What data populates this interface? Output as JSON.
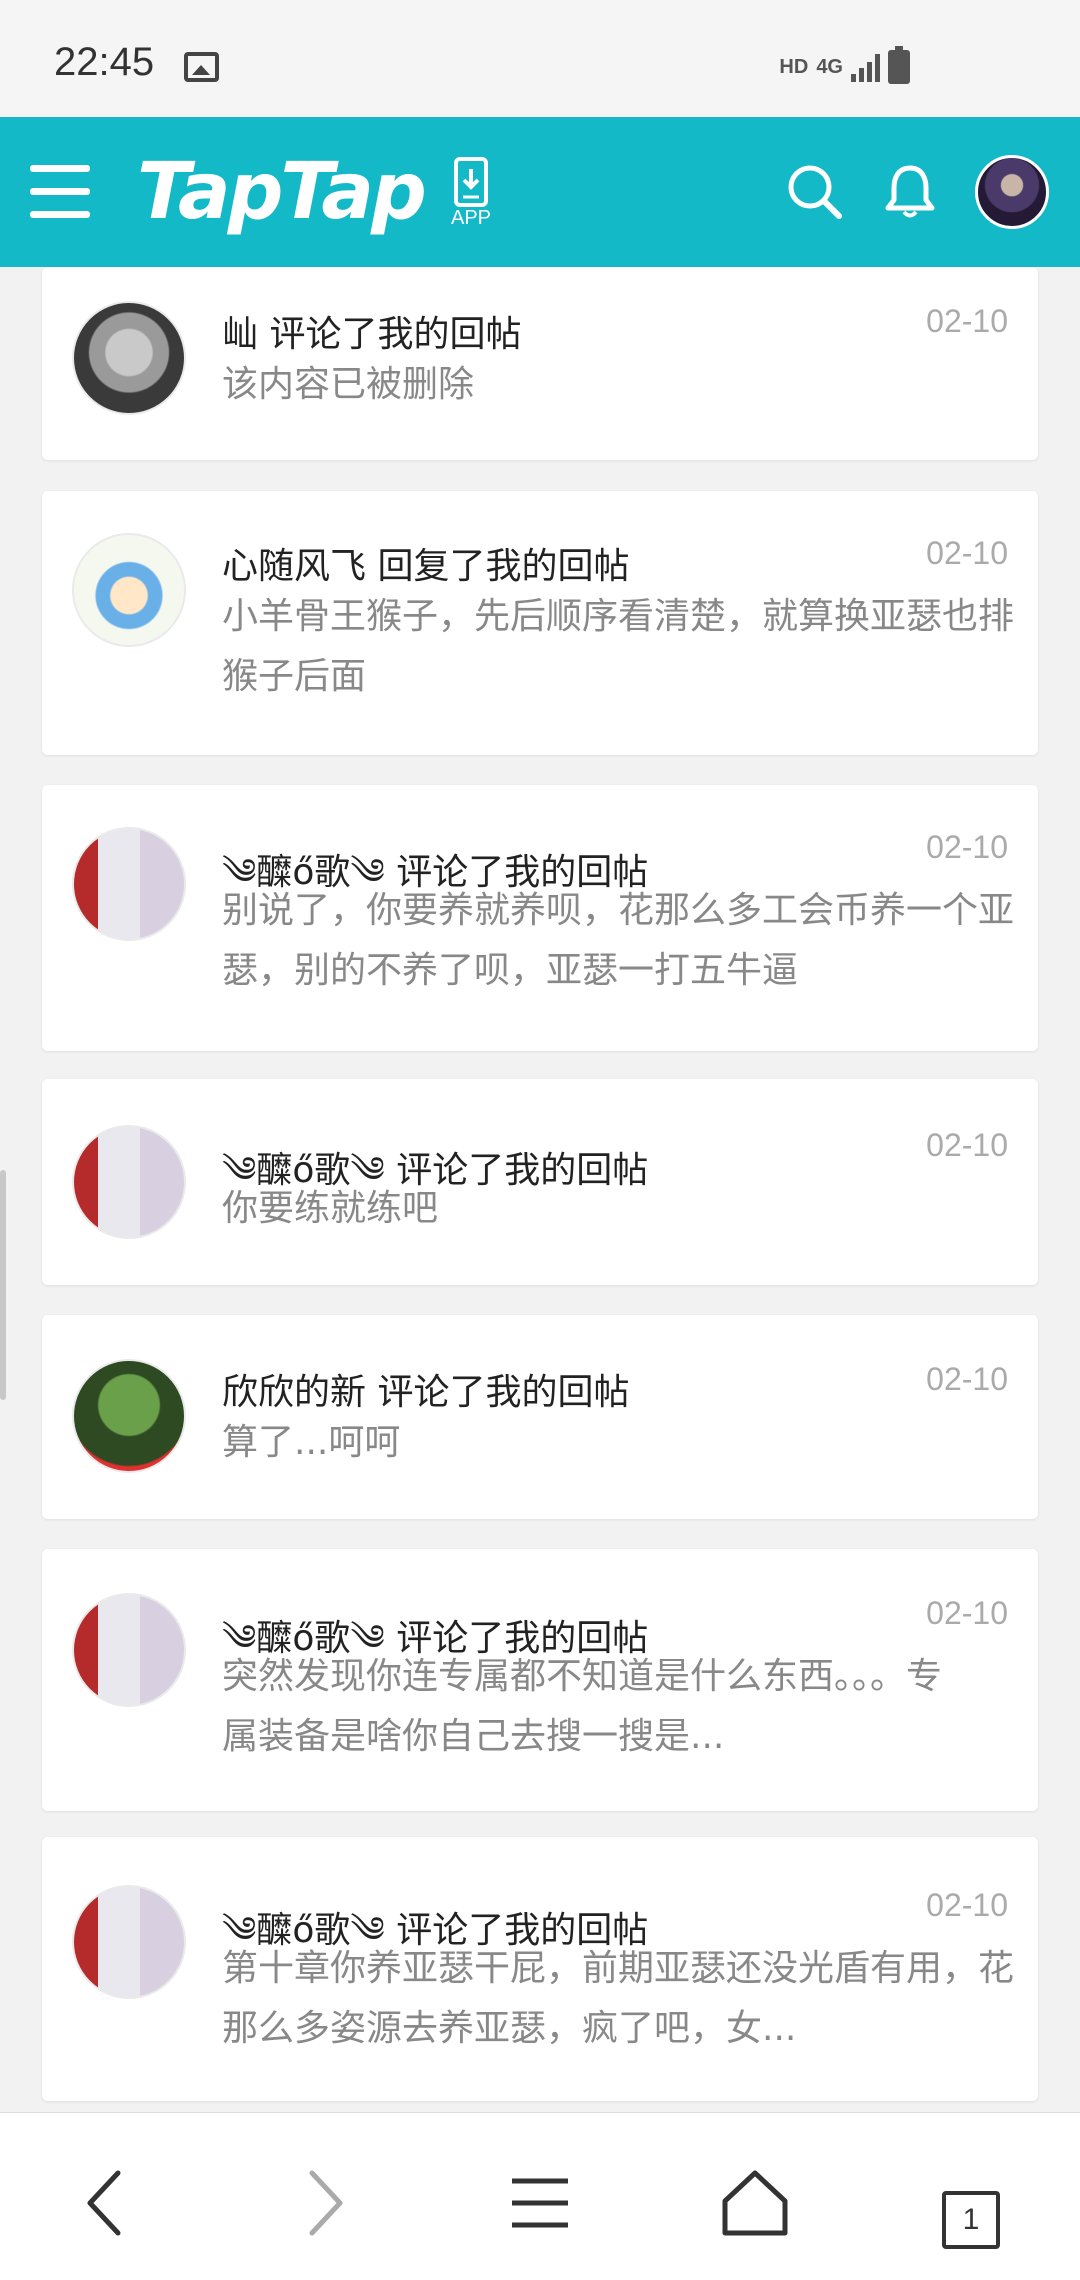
{
  "status_bar": {
    "time": "22:45",
    "hd": "HD",
    "network": "4G"
  },
  "header": {
    "logo": "TapTap",
    "app_label": "APP",
    "accent_color": "#14b9c8"
  },
  "notifications": [
    {
      "user": "屾",
      "action": "评论了我的回帖",
      "date": "02-10",
      "content": "该内容已被删除",
      "avatar": "cat"
    },
    {
      "user": "心随风飞",
      "action": "回复了我的回帖",
      "date": "02-10",
      "content": "小羊骨王猴子，先后顺序看清楚，就算换亚瑟也排猴子后面",
      "avatar": "cartoon"
    },
    {
      "user": "༄醾ő歌༄",
      "action": "评论了我的回帖",
      "date": "02-10",
      "content": "别说了，你要养就养呗，花那么多工会币养一个亚瑟，别的不养了呗，亚瑟一打五牛逼",
      "avatar": "harley"
    },
    {
      "user": "༄醾ő歌༄",
      "action": "评论了我的回帖",
      "date": "02-10",
      "content": "你要练就练吧",
      "avatar": "harley"
    },
    {
      "user": "欣欣的新",
      "action": "评论了我的回帖",
      "date": "02-10",
      "content": "算了...呵呵",
      "avatar": "plant"
    },
    {
      "user": "༄醾ő歌༄",
      "action": "评论了我的回帖",
      "date": "02-10",
      "content": "突然发现你连专属都不知道是什么东西。。。专属装备是啥你自己去搜一搜是...",
      "avatar": "harley"
    },
    {
      "user": "༄醾ő歌༄",
      "action": "评论了我的回帖",
      "date": "02-10",
      "content": "第十章你养亚瑟干屁，前期亚瑟还没光盾有用，花那么多姿源去养亚瑟，疯了吧，女...",
      "avatar": "harley"
    }
  ],
  "bottom_nav": {
    "tabs_count": "1"
  }
}
